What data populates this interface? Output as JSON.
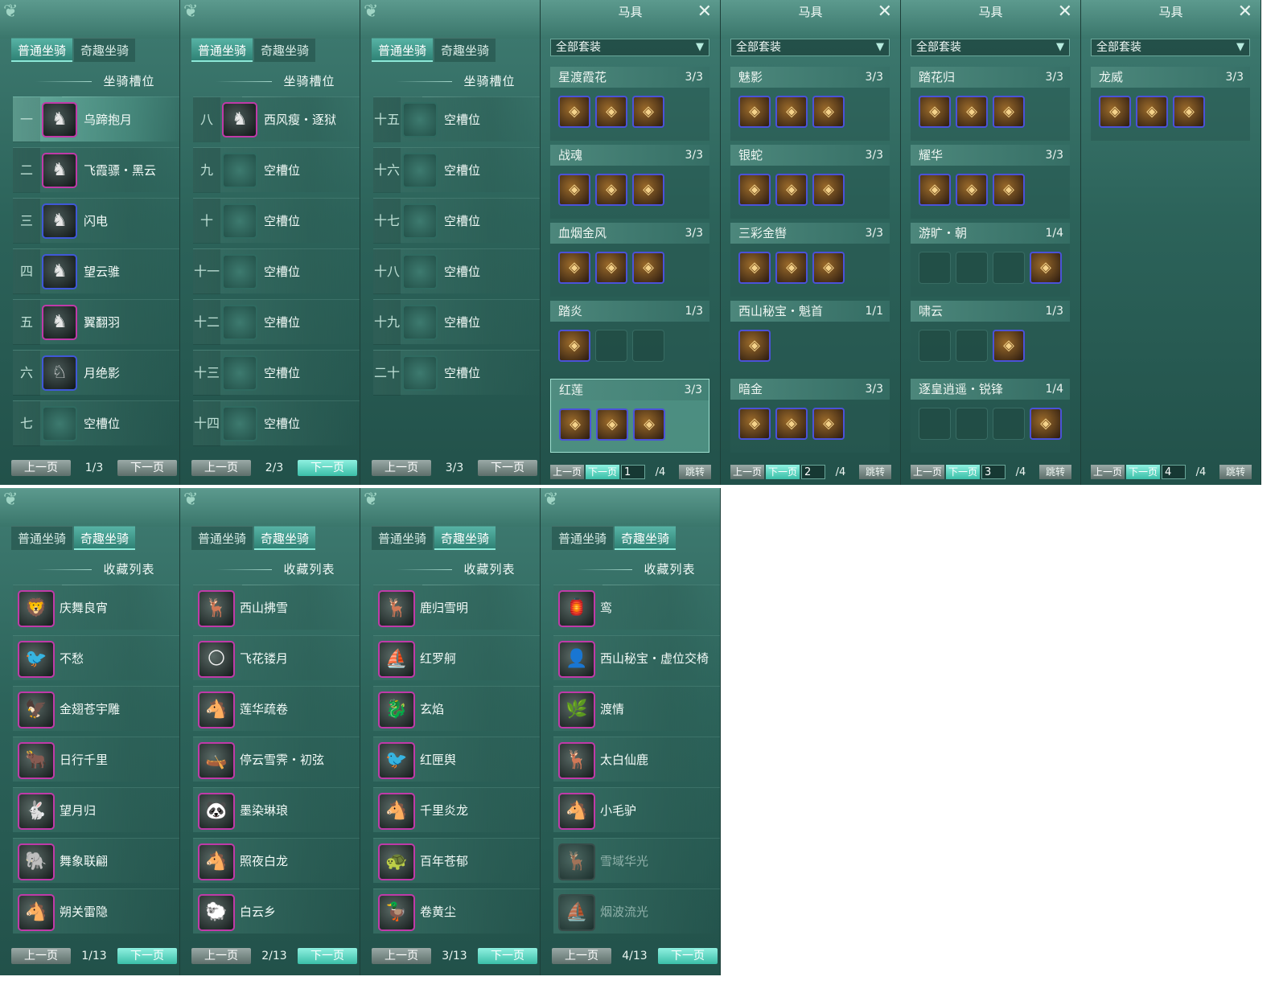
{
  "tabs": {
    "normal": "普通坐骑",
    "fun": "奇趣坐骑"
  },
  "slot_title": "坐骑槽位",
  "collection_title": "收藏列表",
  "pager": {
    "prev": "上一页",
    "next": "下一页"
  },
  "slot_pages": [
    {
      "page": "1/3",
      "rows": [
        {
          "num": "一",
          "name": "乌蹄抱月",
          "icon": "♞",
          "frame": "purple",
          "empty": false,
          "selected": true
        },
        {
          "num": "二",
          "name": "飞霞骠・黑云",
          "icon": "♞",
          "frame": "purple",
          "empty": false,
          "selected": false
        },
        {
          "num": "三",
          "name": "闪电",
          "icon": "♞",
          "frame": "blue",
          "empty": false,
          "selected": false
        },
        {
          "num": "四",
          "name": "望云骓",
          "icon": "♞",
          "frame": "blue",
          "empty": false,
          "selected": false
        },
        {
          "num": "五",
          "name": "翼翻羽",
          "icon": "♞",
          "frame": "purple",
          "empty": false,
          "selected": false
        },
        {
          "num": "六",
          "name": "月绝影",
          "icon": "♘",
          "frame": "blue",
          "empty": false,
          "selected": false
        },
        {
          "num": "七",
          "name": "空槽位",
          "icon": "",
          "frame": "empty",
          "empty": true,
          "selected": false
        }
      ]
    },
    {
      "page": "2/3",
      "rows": [
        {
          "num": "八",
          "name": "西风瘦・逐狱",
          "icon": "♞",
          "frame": "purple",
          "empty": false,
          "selected": false
        },
        {
          "num": "九",
          "name": "空槽位",
          "icon": "",
          "frame": "empty",
          "empty": true,
          "selected": false
        },
        {
          "num": "十",
          "name": "空槽位",
          "icon": "",
          "frame": "empty",
          "empty": true,
          "selected": false
        },
        {
          "num": "十一",
          "name": "空槽位",
          "icon": "",
          "frame": "empty",
          "empty": true,
          "selected": false
        },
        {
          "num": "十二",
          "name": "空槽位",
          "icon": "",
          "frame": "empty",
          "empty": true,
          "selected": false
        },
        {
          "num": "十三",
          "name": "空槽位",
          "icon": "",
          "frame": "empty",
          "empty": true,
          "selected": false
        },
        {
          "num": "十四",
          "name": "空槽位",
          "icon": "",
          "frame": "empty",
          "empty": true,
          "selected": false
        }
      ]
    },
    {
      "page": "3/3",
      "rows": [
        {
          "num": "十五",
          "name": "空槽位",
          "icon": "",
          "frame": "empty",
          "empty": true,
          "selected": false
        },
        {
          "num": "十六",
          "name": "空槽位",
          "icon": "",
          "frame": "empty",
          "empty": true,
          "selected": false
        },
        {
          "num": "十七",
          "name": "空槽位",
          "icon": "",
          "frame": "empty",
          "empty": true,
          "selected": false
        },
        {
          "num": "十八",
          "name": "空槽位",
          "icon": "",
          "frame": "empty",
          "empty": true,
          "selected": false
        },
        {
          "num": "十九",
          "name": "空槽位",
          "icon": "",
          "frame": "empty",
          "empty": true,
          "selected": false
        },
        {
          "num": "二十",
          "name": "空槽位",
          "icon": "",
          "frame": "empty",
          "empty": true,
          "selected": false
        }
      ]
    }
  ],
  "gear": {
    "title": "马具",
    "dropdown": "全部套装",
    "jump": "跳转",
    "total": "/4",
    "pages": [
      {
        "page": "1",
        "sets": [
          {
            "name": "星渡霞花",
            "count": "3/3",
            "items": [
              1,
              1,
              1
            ],
            "selected": false
          },
          {
            "name": "战魂",
            "count": "3/3",
            "items": [
              1,
              1,
              1
            ],
            "selected": false
          },
          {
            "name": "血烟金风",
            "count": "3/3",
            "items": [
              1,
              1,
              1
            ],
            "selected": false
          },
          {
            "name": "踏炎",
            "count": "1/3",
            "items": [
              1,
              0,
              0
            ],
            "selected": false
          },
          {
            "name": "红莲",
            "count": "3/3",
            "items": [
              1,
              1,
              1
            ],
            "selected": true
          }
        ]
      },
      {
        "page": "2",
        "sets": [
          {
            "name": "魅影",
            "count": "3/3",
            "items": [
              1,
              1,
              1
            ],
            "selected": false
          },
          {
            "name": "银蛇",
            "count": "3/3",
            "items": [
              1,
              1,
              1
            ],
            "selected": false
          },
          {
            "name": "三彩金辔",
            "count": "3/3",
            "items": [
              1,
              1,
              1
            ],
            "selected": false
          },
          {
            "name": "西山秘宝・魁首",
            "count": "1/1",
            "items": [
              1
            ],
            "selected": false
          },
          {
            "name": "暗金",
            "count": "3/3",
            "items": [
              1,
              1,
              1
            ],
            "selected": false
          }
        ]
      },
      {
        "page": "3",
        "sets": [
          {
            "name": "踏花归",
            "count": "3/3",
            "items": [
              1,
              1,
              1
            ],
            "selected": false
          },
          {
            "name": "耀华",
            "count": "3/3",
            "items": [
              1,
              1,
              1
            ],
            "selected": false
          },
          {
            "name": "游旷・朝",
            "count": "1/4",
            "items": [
              0,
              0,
              0,
              1
            ],
            "selected": false
          },
          {
            "name": "啸云",
            "count": "1/3",
            "items": [
              0,
              0,
              1
            ],
            "selected": false
          },
          {
            "name": "逐皇逍遥・锐锋",
            "count": "1/4",
            "items": [
              0,
              0,
              0,
              1
            ],
            "selected": false
          }
        ]
      },
      {
        "page": "4",
        "sets": [
          {
            "name": "龙威",
            "count": "3/3",
            "items": [
              1,
              1,
              1
            ],
            "selected": false
          }
        ]
      }
    ]
  },
  "collection_pages": [
    {
      "page": "1/13",
      "items": [
        {
          "name": "庆舞良宵",
          "icon": "🦁",
          "dim": false
        },
        {
          "name": "不愁",
          "icon": "🐦",
          "dim": false
        },
        {
          "name": "金翅苍宇雕",
          "icon": "🦅",
          "dim": false
        },
        {
          "name": "日行千里",
          "icon": "🐂",
          "dim": false
        },
        {
          "name": "望月归",
          "icon": "🐇",
          "dim": false
        },
        {
          "name": "舞象联翩",
          "icon": "🐘",
          "dim": false
        },
        {
          "name": "朔关雷隐",
          "icon": "🐴",
          "dim": false
        }
      ]
    },
    {
      "page": "2/13",
      "items": [
        {
          "name": "西山拂雪",
          "icon": "🦌",
          "dim": false
        },
        {
          "name": "飞花镂月",
          "icon": "🌕",
          "dim": false
        },
        {
          "name": "莲华疏卷",
          "icon": "🐴",
          "dim": false
        },
        {
          "name": "停云雪霁・初弦",
          "icon": "🛶",
          "dim": false
        },
        {
          "name": "墨染琳琅",
          "icon": "🐼",
          "dim": false
        },
        {
          "name": "照夜白龙",
          "icon": "🐴",
          "dim": false
        },
        {
          "name": "白云乡",
          "icon": "🐑",
          "dim": false
        }
      ]
    },
    {
      "page": "3/13",
      "items": [
        {
          "name": "鹿归雪明",
          "icon": "🦌",
          "dim": false
        },
        {
          "name": "红罗舸",
          "icon": "⛵",
          "dim": false
        },
        {
          "name": "玄焰",
          "icon": "🐉",
          "dim": false
        },
        {
          "name": "红匣舆",
          "icon": "🐦",
          "dim": false
        },
        {
          "name": "千里炎龙",
          "icon": "🐴",
          "dim": false
        },
        {
          "name": "百年苍郁",
          "icon": "🐢",
          "dim": false
        },
        {
          "name": "卷黄尘",
          "icon": "🦆",
          "dim": false
        }
      ]
    },
    {
      "page": "4/13",
      "items": [
        {
          "name": "鸾",
          "icon": "🏮",
          "dim": false
        },
        {
          "name": "西山秘宝・虚位交椅",
          "icon": "👤",
          "dim": false
        },
        {
          "name": "渡情",
          "icon": "🌿",
          "dim": false
        },
        {
          "name": "太白仙鹿",
          "icon": "🦌",
          "dim": false
        },
        {
          "name": "小毛驴",
          "icon": "🐴",
          "dim": false
        },
        {
          "name": "雪域华光",
          "icon": "🦌",
          "dim": true
        },
        {
          "name": "烟波流光",
          "icon": "⛵",
          "dim": true
        }
      ]
    }
  ]
}
